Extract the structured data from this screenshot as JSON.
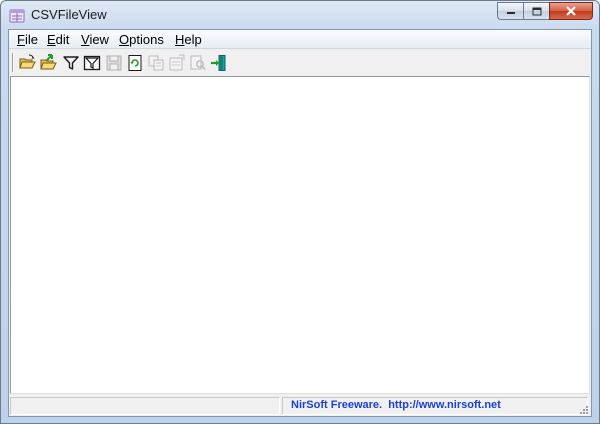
{
  "window": {
    "title": "CSVFileView",
    "app_icon": "csv-file-icon"
  },
  "menu": {
    "items": [
      {
        "label": "File",
        "accel": "F",
        "rest": "ile"
      },
      {
        "label": "Edit",
        "accel": "E",
        "rest": "dit"
      },
      {
        "label": "View",
        "accel": "V",
        "rest": "iew"
      },
      {
        "label": "Options",
        "accel": "O",
        "rest": "ptions"
      },
      {
        "label": "Help",
        "accel": "H",
        "rest": "elp"
      }
    ]
  },
  "toolbar": {
    "buttons": [
      {
        "icon": "open-folder-icon",
        "enabled": true
      },
      {
        "icon": "open-folder-green-arrow-icon",
        "enabled": true
      },
      {
        "icon": "filter-icon",
        "enabled": true
      },
      {
        "icon": "advanced-filter-icon",
        "enabled": true
      },
      {
        "icon": "save-icon",
        "enabled": false
      },
      {
        "icon": "refresh-icon",
        "enabled": true
      },
      {
        "icon": "copy-icon",
        "enabled": false
      },
      {
        "icon": "properties-icon",
        "enabled": false
      },
      {
        "icon": "find-icon",
        "enabled": false
      },
      {
        "icon": "exit-icon",
        "enabled": true
      }
    ]
  },
  "status": {
    "link_text": "NirSoft Freeware.  http://www.nirsoft.net",
    "link_color": "#1b3fd6"
  }
}
